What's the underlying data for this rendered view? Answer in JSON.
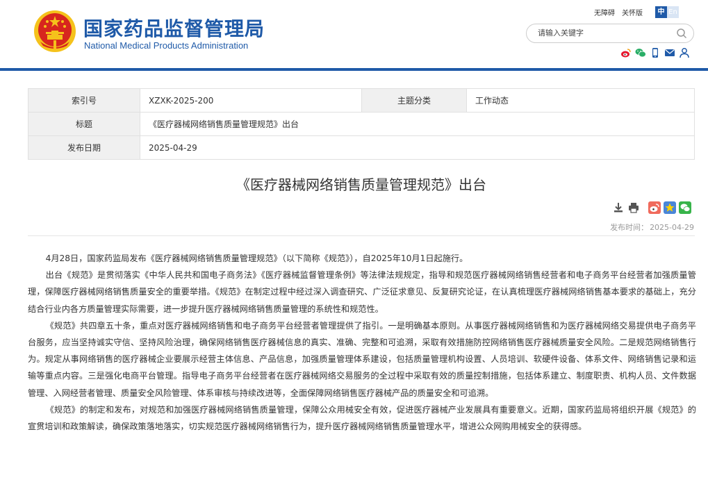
{
  "header": {
    "title_cn": "国家药品监督管理局",
    "title_en": "National Medical Products Administration",
    "links": {
      "accessibility": "无障碍",
      "care": "关怀版"
    },
    "lang": {
      "zh": "中",
      "en": "En"
    },
    "search": {
      "placeholder": "请输入关键字"
    },
    "share_icons": [
      "weibo-icon",
      "wechat-icon",
      "mobile-icon",
      "mail-icon",
      "user-icon"
    ],
    "colors": {
      "brand": "#1f5aa8",
      "emblem_red": "#d7261e",
      "emblem_gold": "#f5c21b"
    }
  },
  "info_table": {
    "index_label": "索引号",
    "index_value": "XZXK-2025-200",
    "category_label": "主题分类",
    "category_value": "工作动态",
    "title_label": "标题",
    "title_value": "《医疗器械网络销售质量管理规范》出台",
    "date_label": "发布日期",
    "date_value": "2025-04-29"
  },
  "article": {
    "title": "《医疗器械网络销售质量管理规范》出台",
    "tool_icons": [
      "download-icon",
      "print-icon",
      "weibo-share-icon",
      "favorite-icon",
      "wechat-share-icon"
    ],
    "pubdate_label": "发布时间：",
    "pubdate_value": "2025-04-29",
    "paragraphs": [
      "4月28日，国家药监局发布《医疗器械网络销售质量管理规范》（以下简称《规范》），自2025年10月1日起施行。",
      "出台《规范》是贯彻落实《中华人民共和国电子商务法》《医疗器械监督管理条例》等法律法规规定，指导和规范医疗器械网络销售经营者和电子商务平台经营者加强质量管理，保障医疗器械网络销售质量安全的重要举措。《规范》在制定过程中经过深入调查研究、广泛征求意见、反复研究论证，在认真梳理医疗器械网络销售基本要求的基础上，充分结合行业内各方质量管理实际需要，进一步提升医疗器械网络销售质量管理的系统性和规范性。",
      "《规范》共四章五十条，重点对医疗器械网络销售和电子商务平台经营者管理提供了指引。一是明确基本原则。从事医疗器械网络销售和为医疗器械网络交易提供电子商务平台服务，应当坚持诚实守信、坚持风险治理，确保网络销售医疗器械信息的真实、准确、完整和可追溯，采取有效措施防控网络销售医疗器械质量安全风险。二是规范网络销售行为。规定从事网络销售的医疗器械企业要展示经营主体信息、产品信息，加强质量管理体系建设，包括质量管理机构设置、人员培训、软硬件设备、体系文件、网络销售记录和运输等重点内容。三是强化电商平台管理。指导电子商务平台经营者在医疗器械网络交易服务的全过程中采取有效的质量控制措施，包括体系建立、制度职责、机构人员、文件数据管理、入网经营者管理、质量安全风险管理、体系审核与持续改进等，全面保障网络销售医疗器械产品的质量安全和可追溯。",
      "《规范》的制定和发布，对规范和加强医疗器械网络销售质量管理，保障公众用械安全有效，促进医疗器械产业发展具有重要意义。近期，国家药监局将组织开展《规范》的宣贯培训和政策解读，确保政策落地落实，切实规范医疗器械网络销售行为，提升医疗器械网络销售质量管理水平，增进公众网购用械安全的获得感。"
    ]
  }
}
